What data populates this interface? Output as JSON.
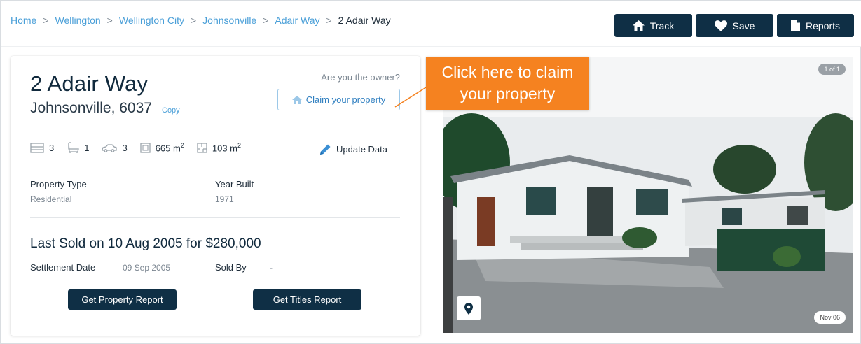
{
  "breadcrumb": {
    "items": [
      "Home",
      "Wellington",
      "Wellington City",
      "Johnsonville",
      "Adair Way"
    ],
    "current": "2 Adair Way",
    "separator": ">"
  },
  "actions": {
    "track_label": "Track",
    "save_label": "Save",
    "reports_label": "Reports"
  },
  "property": {
    "title": "2 Adair Way",
    "subtitle": "Johnsonville, 6037",
    "copy_label": "Copy",
    "owner_question": "Are you the owner?",
    "claim_label": "Claim your property",
    "features": {
      "bedrooms": "3",
      "bathrooms": "1",
      "parking": "3",
      "land_area": "665 m",
      "floor_area": "103 m",
      "area_unit_sup": "2"
    },
    "update_label": "Update Data",
    "property_type_label": "Property Type",
    "property_type_value": "Residential",
    "year_built_label": "Year Built",
    "year_built_value": "1971"
  },
  "sale": {
    "title": "Last Sold on 10 Aug 2005 for $280,000",
    "settlement_label": "Settlement Date",
    "settlement_value": "09 Sep 2005",
    "sold_by_label": "Sold By",
    "sold_by_value": "-"
  },
  "reports": {
    "property_report_label": "Get Property Report",
    "titles_report_label": "Get Titles Report"
  },
  "photo": {
    "counter": "1 of 1",
    "date": "Nov 06"
  },
  "callout": {
    "line1": "Click here to claim",
    "line2": "your property"
  },
  "colors": {
    "primary_dark": "#0f2f45",
    "link_blue": "#4a9fd8",
    "callout_orange": "#f58220"
  },
  "icons": {
    "track": "home-icon",
    "save": "heart-icon",
    "reports": "document-icon",
    "claim": "house-icon",
    "bed": "bed-icon",
    "bath": "bath-icon",
    "car": "car-icon",
    "land": "land-area-icon",
    "floor": "floor-plan-icon",
    "update": "pencil-icon",
    "map": "map-pin-icon"
  }
}
